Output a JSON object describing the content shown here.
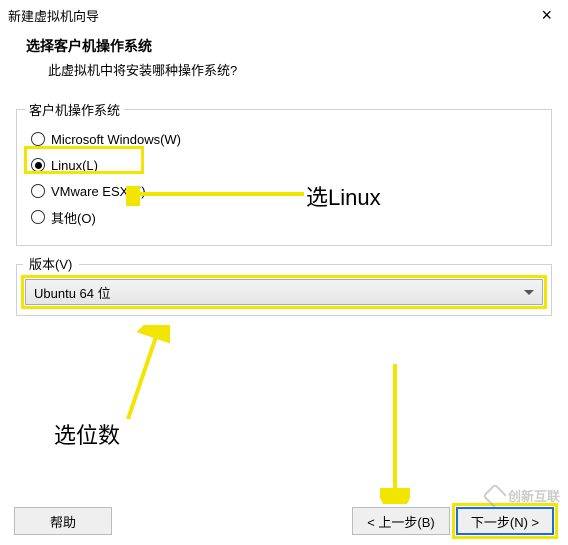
{
  "title": "新建虚拟机向导",
  "close_label": "×",
  "header": {
    "title": "选择客户机操作系统",
    "subtitle": "此虚拟机中将安装哪种操作系统?"
  },
  "os_group": {
    "legend": "客户机操作系统",
    "options": [
      {
        "label": "Microsoft Windows(W)",
        "selected": false
      },
      {
        "label": "Linux(L)",
        "selected": true
      },
      {
        "label": "VMware ESX(X)",
        "selected": false
      },
      {
        "label": "其他(O)",
        "selected": false
      }
    ]
  },
  "version_group": {
    "legend": "版本(V)",
    "selected": "Ubuntu 64 位"
  },
  "annotations": {
    "linux_label": "选Linux",
    "bits_label": "选位数"
  },
  "buttons": {
    "help": "帮助",
    "back": "< 上一步(B)",
    "next": "下一步(N) >",
    "cancel_hidden": ""
  },
  "watermark": "创新互联"
}
